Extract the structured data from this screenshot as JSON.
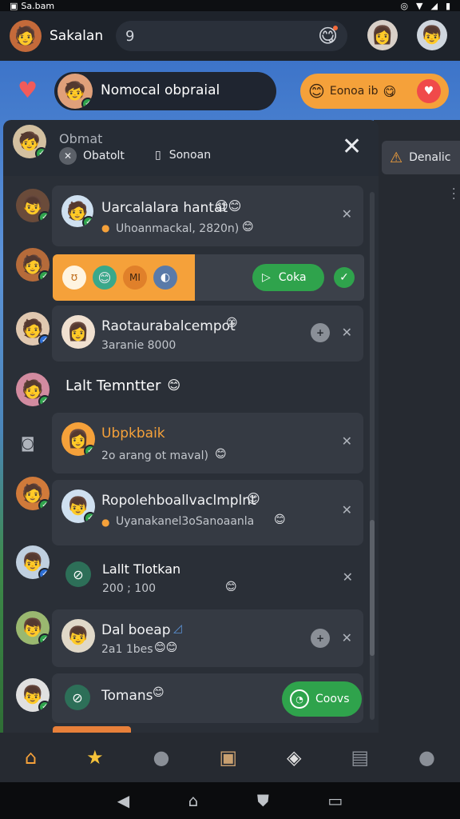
{
  "status_bar": {
    "left_text": "Sa.bam"
  },
  "topbar": {
    "title": "Sakalan",
    "search_glyph": "9"
  },
  "banner": {
    "name": "Nomocal obpraial",
    "promo_label": "Eonoa ib"
  },
  "header": {
    "title": "Obmat",
    "chip1": "Obatolt",
    "chip2": "Sonoan",
    "side_tab": "Denalic"
  },
  "cards": [
    {
      "title": "Uarcalalara hantat",
      "sub": "Uhoanmackal, 2820n)"
    },
    {
      "action_label": "Coka",
      "chip": "MI"
    },
    {
      "title": "Raotaurabalcempot",
      "sub": "3aranie 8000"
    },
    {
      "section": "Lalt Temntter"
    },
    {
      "title": "Ubpkbaik",
      "sub": "2o arang ot maval)"
    },
    {
      "title": "Ropolehboallvaclmplnt",
      "sub": "Uyanakanel3oSanoaanla"
    },
    {
      "title": "Lallt Tlotkan",
      "sub": "200 ; 100"
    },
    {
      "title": "Dal boeap",
      "sub": "2a1 1bes"
    },
    {
      "title": "Tomans",
      "action_label": "Coovs"
    }
  ],
  "colors": {
    "accent_orange": "#f5a13a",
    "accent_green": "#2fa34c",
    "panel": "#2a2f37",
    "card": "#353a43"
  }
}
